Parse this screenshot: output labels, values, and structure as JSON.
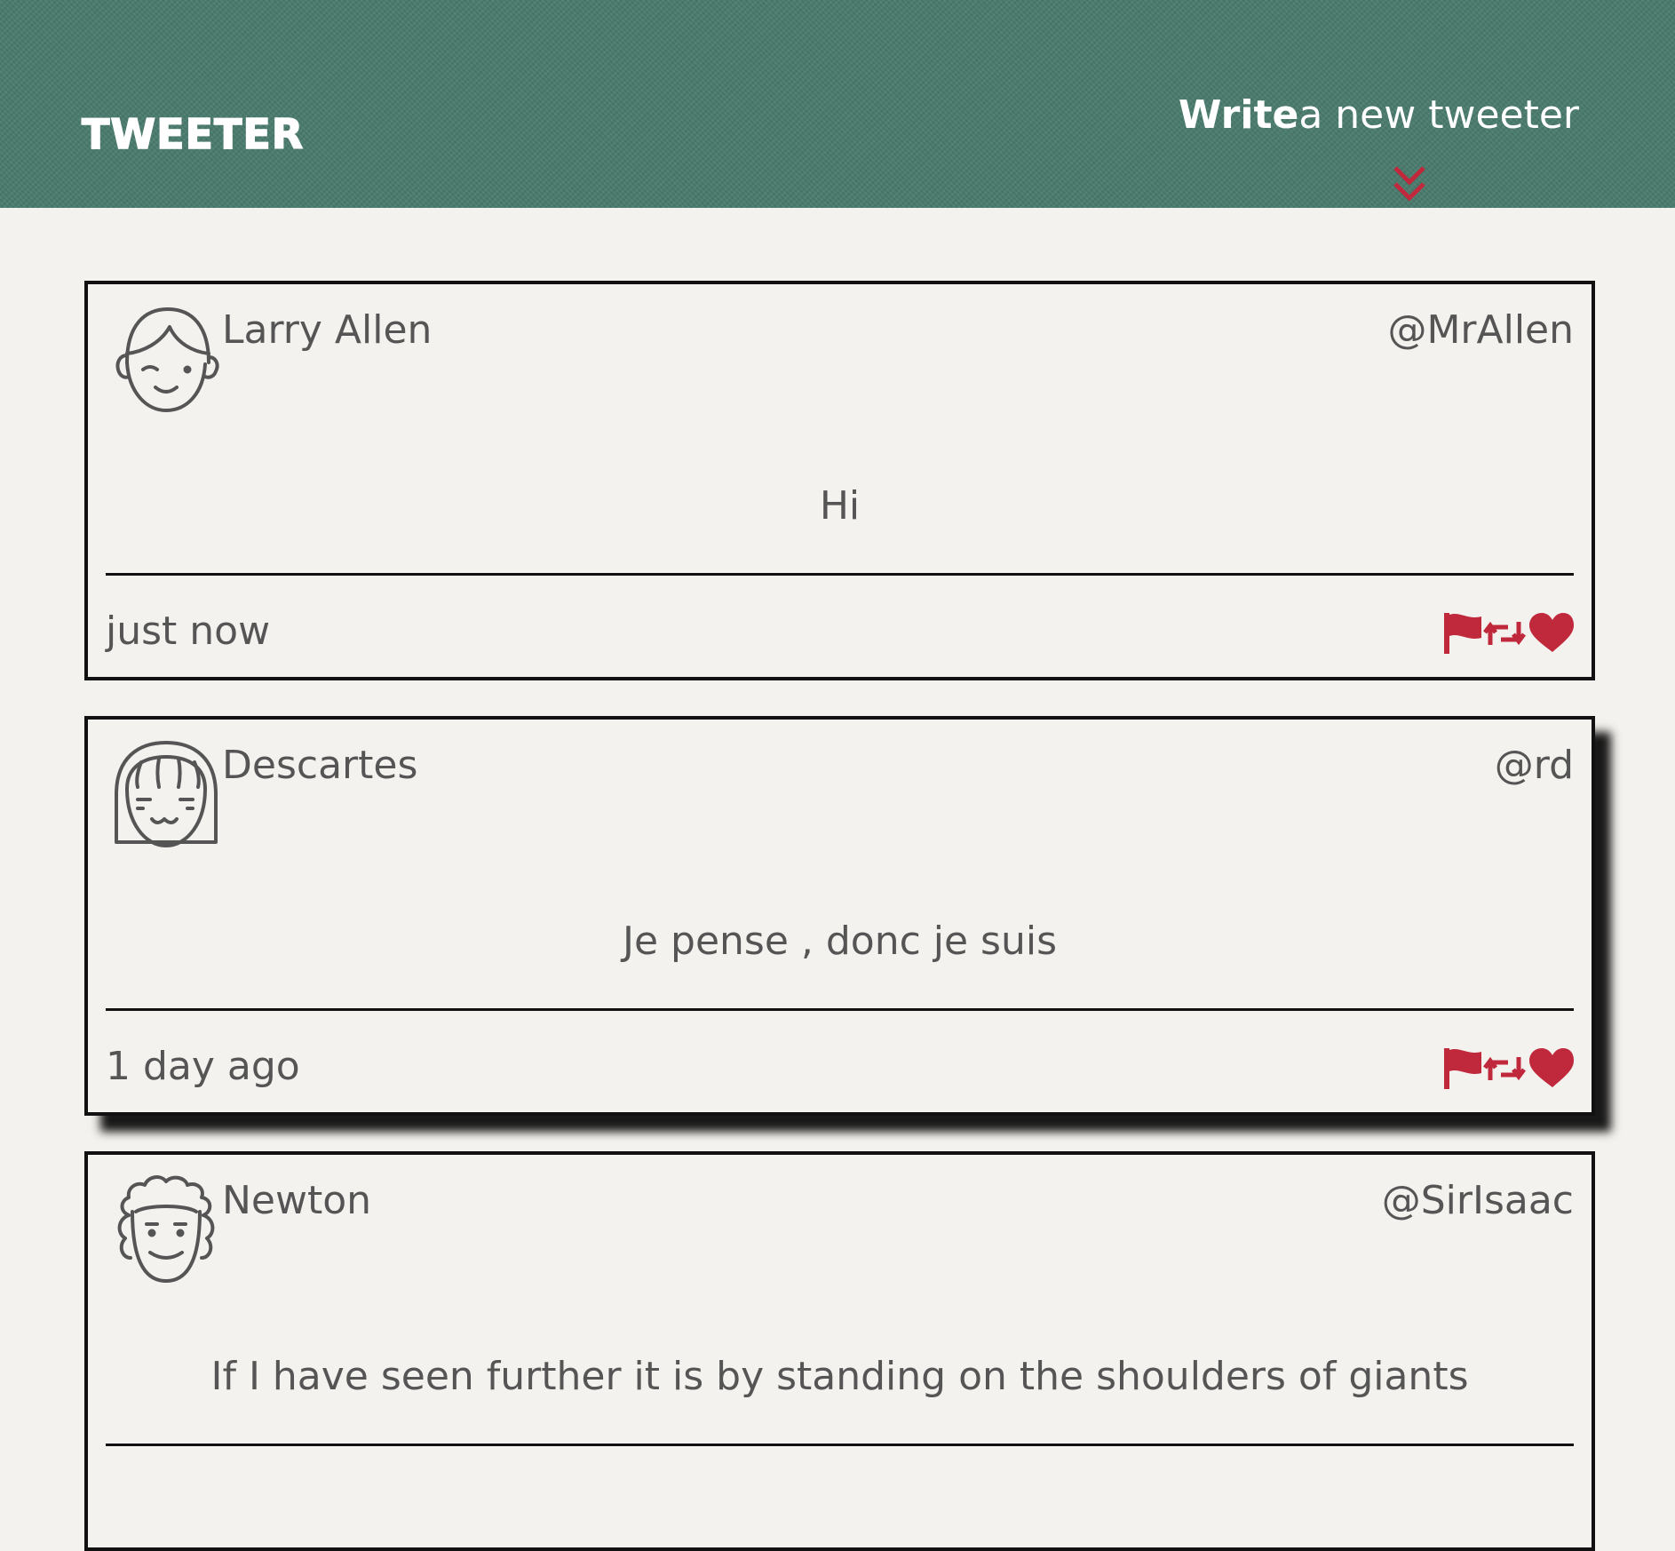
{
  "header": {
    "brand": "TWEETER",
    "compose_bold": "Write",
    "compose_rest": "a new tweeter",
    "compose_icon": "double-chevron-down-icon"
  },
  "colors": {
    "header_bg": "#4a7c6e",
    "page_bg": "#f4f2ee",
    "accent": "#c0283c",
    "text": "#555555"
  },
  "tweets": [
    {
      "avatar_icon": "smiling-boy-avatar-icon",
      "name": "Larry Allen",
      "handle": "@MrAllen",
      "text": "Hi",
      "time": "just now"
    },
    {
      "avatar_icon": "smiling-girl-avatar-icon",
      "name": "Descartes",
      "handle": "@rd",
      "text": "Je pense , donc je suis",
      "time": "1 day ago"
    },
    {
      "avatar_icon": "curly-hair-avatar-icon",
      "name": "Newton",
      "handle": "@SirIsaac",
      "text": "If I have seen further it is by standing on the shoulders of giants",
      "time": ""
    }
  ],
  "actions": [
    "flag-icon",
    "retweet-icon",
    "heart-icon"
  ]
}
